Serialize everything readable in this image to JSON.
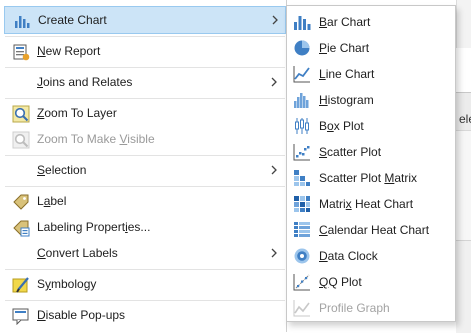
{
  "background": {
    "partial_text": "ele"
  },
  "menu": {
    "items": [
      {
        "label": "Create Chart",
        "icon": "chart-icon",
        "has_submenu": true,
        "highlighted": true
      },
      {
        "label": "New Report",
        "icon": "report-icon"
      },
      {
        "label": "Joins and Relates",
        "has_submenu": true
      },
      {
        "label": "Zoom To Layer",
        "icon": "zoom-layer-icon"
      },
      {
        "label": "Zoom To Make Visible",
        "icon": "zoom-visible-icon",
        "disabled": true
      },
      {
        "label": "Selection",
        "has_submenu": true
      },
      {
        "label": "Label",
        "icon": "label-icon"
      },
      {
        "label": "Labeling Properties...",
        "icon": "labeling-properties-icon"
      },
      {
        "label": "Convert Labels",
        "has_submenu": true
      },
      {
        "label": "Symbology",
        "icon": "symbology-icon"
      },
      {
        "label": "Disable Pop-ups",
        "icon": "popup-icon"
      }
    ]
  },
  "submenu": {
    "items": [
      {
        "label": "Bar Chart",
        "icon": "bar-chart-icon"
      },
      {
        "label": "Pie Chart",
        "icon": "pie-chart-icon"
      },
      {
        "label": "Line Chart",
        "icon": "line-chart-icon"
      },
      {
        "label": "Histogram",
        "icon": "histogram-icon"
      },
      {
        "label": "Box Plot",
        "icon": "box-plot-icon"
      },
      {
        "label": "Scatter Plot",
        "icon": "scatter-plot-icon"
      },
      {
        "label": "Scatter Plot Matrix",
        "icon": "scatter-matrix-icon"
      },
      {
        "label": "Matrix Heat Chart",
        "icon": "matrix-heat-icon"
      },
      {
        "label": "Calendar Heat Chart",
        "icon": "calendar-heat-icon"
      },
      {
        "label": "Data Clock",
        "icon": "data-clock-icon"
      },
      {
        "label": "QQ Plot",
        "icon": "qq-plot-icon"
      },
      {
        "label": "Profile Graph",
        "icon": "profile-graph-icon",
        "disabled": true
      }
    ]
  }
}
